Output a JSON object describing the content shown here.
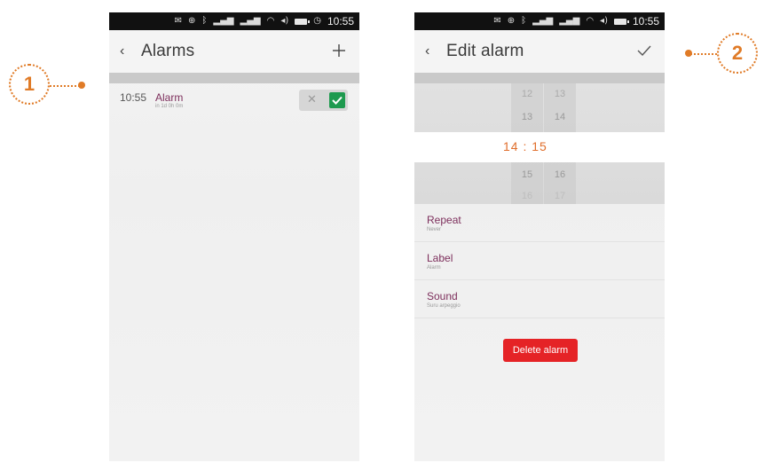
{
  "status_bar": {
    "time": "10:55"
  },
  "screen1": {
    "title": "Alarms",
    "alarm": {
      "time": "10:55",
      "name": "Alarm",
      "subtitle": "in 1d 0h 0m"
    },
    "toggle": {
      "enabled": true
    }
  },
  "screen2": {
    "title": "Edit alarm",
    "picker": {
      "hours": [
        "12",
        "13",
        "15",
        "16"
      ],
      "minutes": [
        "13",
        "14",
        "16",
        "17"
      ],
      "selected": "14 : 15"
    },
    "settings": [
      {
        "title": "Repeat",
        "value": "Never"
      },
      {
        "title": "Label",
        "value": "Alarm"
      },
      {
        "title": "Sound",
        "value": "Suru arpeggio"
      }
    ],
    "delete_label": "Delete alarm"
  },
  "callouts": {
    "one": "1",
    "two": "2"
  },
  "colors": {
    "accent_orange": "#e07b27",
    "label_purple": "#7d2f5c",
    "delete_red": "#e52326",
    "toggle_green": "#1e9a4f",
    "picker_selected": "#e06e2b"
  },
  "icons": [
    "back-chevron-icon",
    "add-icon",
    "checkmark-icon",
    "close-x-icon"
  ]
}
